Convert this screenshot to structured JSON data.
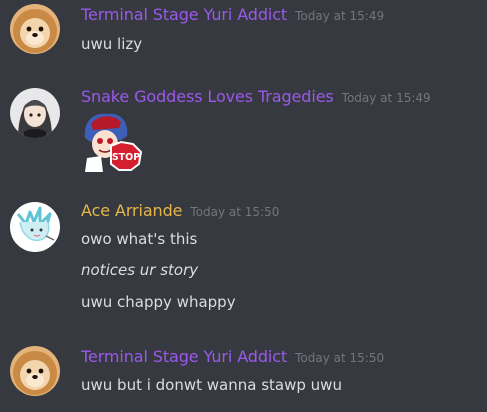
{
  "colors": {
    "background": "#36393f",
    "purple_name": "#9b59ec",
    "gold_name": "#e6b64a",
    "timestamp": "#72767d",
    "text": "#dcddde"
  },
  "messages": [
    {
      "username": "Terminal Stage Yuri Addict",
      "name_color": "#9b59ec",
      "timestamp": "Today at 15:49",
      "avatar": "pomeranian-avatar",
      "lines": [
        "uwu lizy"
      ]
    },
    {
      "username": "Snake Goddess Loves Tragedies",
      "name_color": "#9b59ec",
      "timestamp": "Today at 15:49",
      "avatar": "anime-girl-avatar",
      "emote": "stop-sign-emote",
      "emote_text": "STOP"
    },
    {
      "username": "Ace Arriande",
      "name_color": "#e6b64a",
      "timestamp": "Today at 15:50",
      "avatar": "sketch-character-avatar",
      "lines": [
        "owo what's this",
        "notices ur story",
        "uwu chappy whappy"
      ]
    },
    {
      "username": "Terminal Stage Yuri Addict",
      "name_color": "#9b59ec",
      "timestamp": "Today at 15:50",
      "avatar": "pomeranian-avatar",
      "lines": [
        "uwu but i donwt wanna stawp uwu"
      ]
    }
  ]
}
